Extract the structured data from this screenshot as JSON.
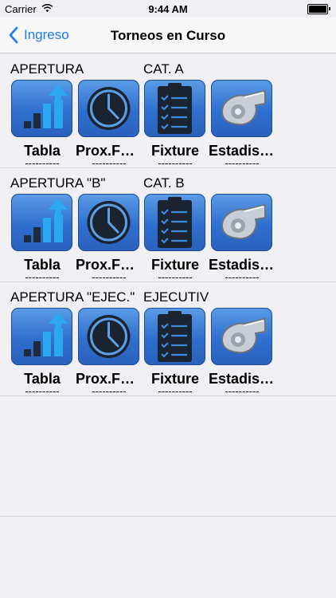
{
  "status_bar": {
    "carrier": "Carrier",
    "time": "9:44 AM"
  },
  "nav": {
    "back_label": "Ingreso",
    "title": "Torneos en Curso"
  },
  "sections": [
    {
      "name": "APERTURA",
      "category": "CAT. A",
      "buttons": [
        {
          "label": "Tabla",
          "icon": "bar-chart-icon",
          "dashes": "----------"
        },
        {
          "label": "Prox.Fecha",
          "icon": "clock-icon",
          "dashes": "----------"
        },
        {
          "label": "Fixture",
          "icon": "clipboard-checklist-icon",
          "dashes": "----------"
        },
        {
          "label": "Estadisticas",
          "icon": "whistle-icon",
          "dashes": "----------"
        }
      ]
    },
    {
      "name": "APERTURA \"B\"",
      "category": "CAT. B",
      "buttons": [
        {
          "label": "Tabla",
          "icon": "bar-chart-icon",
          "dashes": "----------"
        },
        {
          "label": "Prox.Fecha",
          "icon": "clock-icon",
          "dashes": "----------"
        },
        {
          "label": "Fixture",
          "icon": "clipboard-checklist-icon",
          "dashes": "----------"
        },
        {
          "label": "Estadisticas",
          "icon": "whistle-icon",
          "dashes": "----------"
        }
      ]
    },
    {
      "name": "APERTURA \"EJEC.\"",
      "category": "EJECUTIVOS",
      "buttons": [
        {
          "label": "Tabla",
          "icon": "bar-chart-icon",
          "dashes": "----------"
        },
        {
          "label": "Prox.Fecha",
          "icon": "clock-icon",
          "dashes": "----------"
        },
        {
          "label": "Fixture",
          "icon": "clipboard-checklist-icon",
          "dashes": "----------"
        },
        {
          "label": "Estadisticas",
          "icon": "whistle-icon",
          "dashes": "----------"
        }
      ]
    }
  ],
  "colors": {
    "accent": "#1a7cf0",
    "tile": "#3a7bd9",
    "background": "#efeff4"
  }
}
